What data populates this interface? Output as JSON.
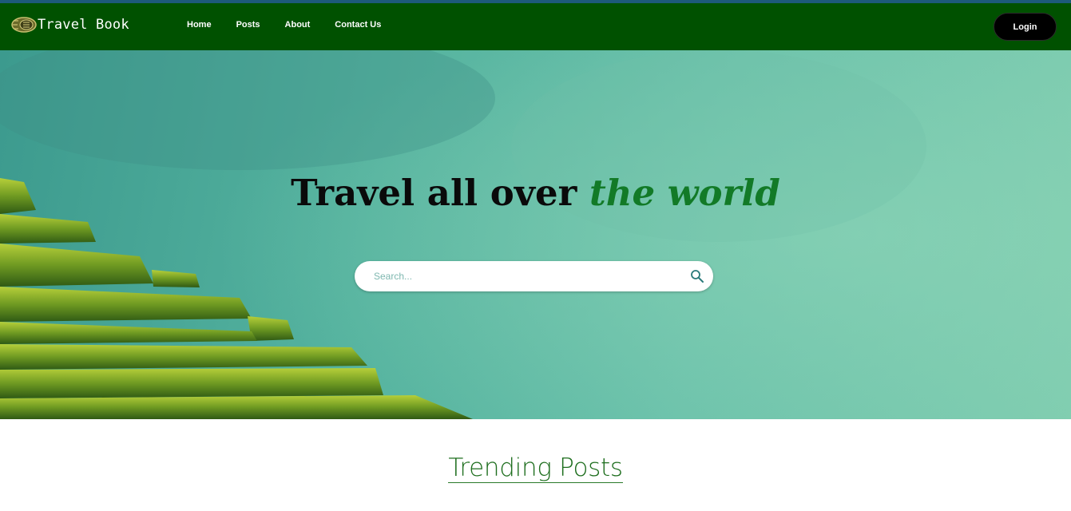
{
  "colors": {
    "navbar": "#005100",
    "accent_green": "#127a27",
    "hero_teal": "#5fbaa3",
    "login_bg": "#000000"
  },
  "navbar": {
    "brand": "Travel Book",
    "logo_icon": "travel-book-logo-icon",
    "links": [
      "Home",
      "Posts",
      "About",
      "Contact Us"
    ],
    "login_label": "Login"
  },
  "hero": {
    "title_main": "Travel all over ",
    "title_accent": "the world",
    "search": {
      "placeholder": "Search...",
      "value": "",
      "icon": "search-icon"
    }
  },
  "sections": {
    "trending_title": "Trending Posts"
  }
}
